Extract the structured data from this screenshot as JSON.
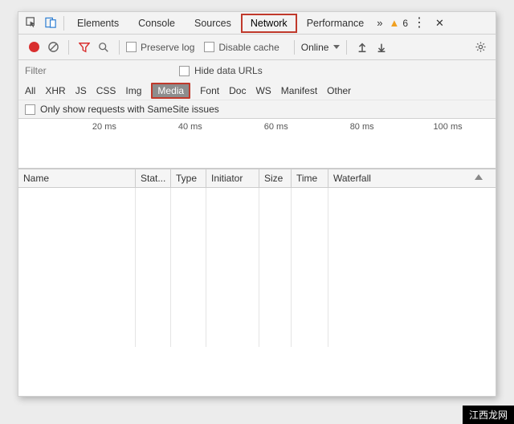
{
  "tabs": {
    "elements": "Elements",
    "console": "Console",
    "sources": "Sources",
    "network": "Network",
    "performance": "Performance"
  },
  "warning_count": "6",
  "toolbar": {
    "preserve_log": "Preserve log",
    "disable_cache": "Disable cache",
    "online": "Online"
  },
  "filter": {
    "placeholder": "Filter",
    "hide_urls": "Hide data URLs"
  },
  "types": {
    "all": "All",
    "xhr": "XHR",
    "js": "JS",
    "css": "CSS",
    "img": "Img",
    "media": "Media",
    "font": "Font",
    "doc": "Doc",
    "ws": "WS",
    "manifest": "Manifest",
    "other": "Other"
  },
  "samesite_label": "Only show requests with SameSite issues",
  "timeline": {
    "t1": "20 ms",
    "t2": "40 ms",
    "t3": "60 ms",
    "t4": "80 ms",
    "t5": "100 ms"
  },
  "columns": {
    "name": "Name",
    "status": "Stat...",
    "type": "Type",
    "initiator": "Initiator",
    "size": "Size",
    "time": "Time",
    "waterfall": "Waterfall"
  },
  "watermark": "江西龙网"
}
